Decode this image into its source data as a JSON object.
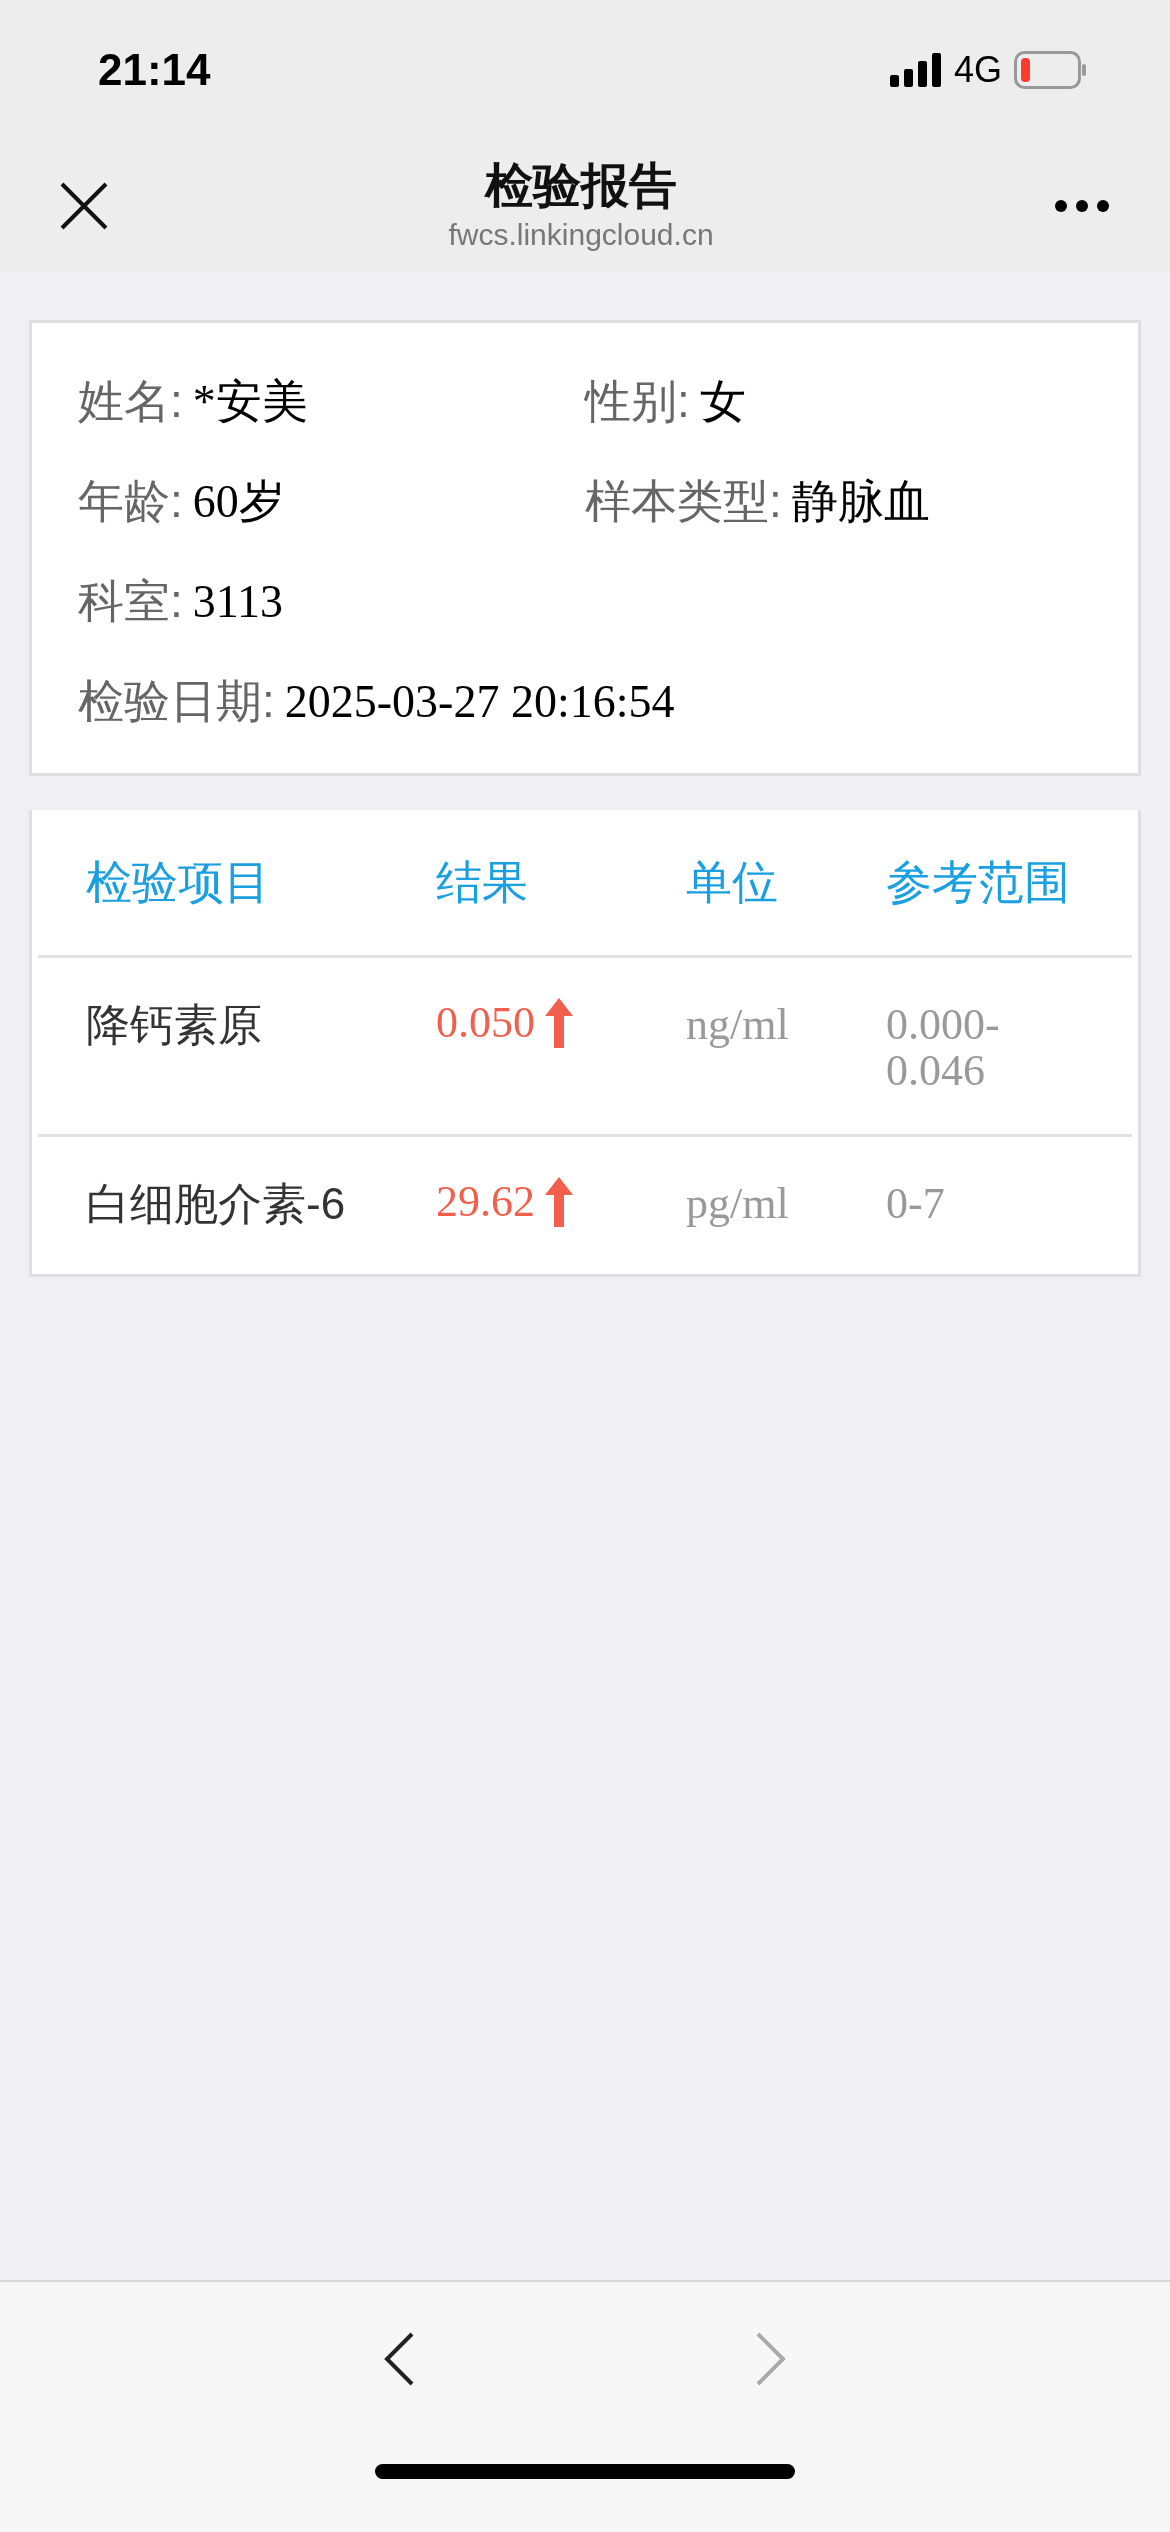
{
  "status_bar": {
    "time": "21:14",
    "network": "4G",
    "battery_low": true
  },
  "nav_bar": {
    "title": "检验报告",
    "url": "fwcs.linkingcloud.cn"
  },
  "patient": {
    "rows": [
      [
        {
          "label": "姓名:",
          "value": "*安美"
        },
        {
          "label": "性别:",
          "value": "女"
        }
      ],
      [
        {
          "label": "年龄:",
          "value": "60岁"
        },
        {
          "label": "样本类型:",
          "value": "静脉血"
        }
      ],
      [
        {
          "label": "科室:",
          "value": "3113"
        }
      ],
      [
        {
          "label": "检验日期:",
          "value": "2025-03-27 20:16:54"
        }
      ]
    ]
  },
  "table": {
    "columns": [
      "检验项目",
      "结果",
      "单位",
      "参考范围"
    ],
    "rows": [
      {
        "item": "降钙素原",
        "result": "0.050",
        "high": true,
        "unit": "ng/ml",
        "range": "0.000-\n0.046"
      },
      {
        "item": "白细胞介素-6",
        "result": "29.62",
        "high": true,
        "unit": "pg/ml",
        "range": "0-7"
      }
    ]
  },
  "toolbar": {
    "back_disabled": false,
    "forward_disabled": true
  }
}
